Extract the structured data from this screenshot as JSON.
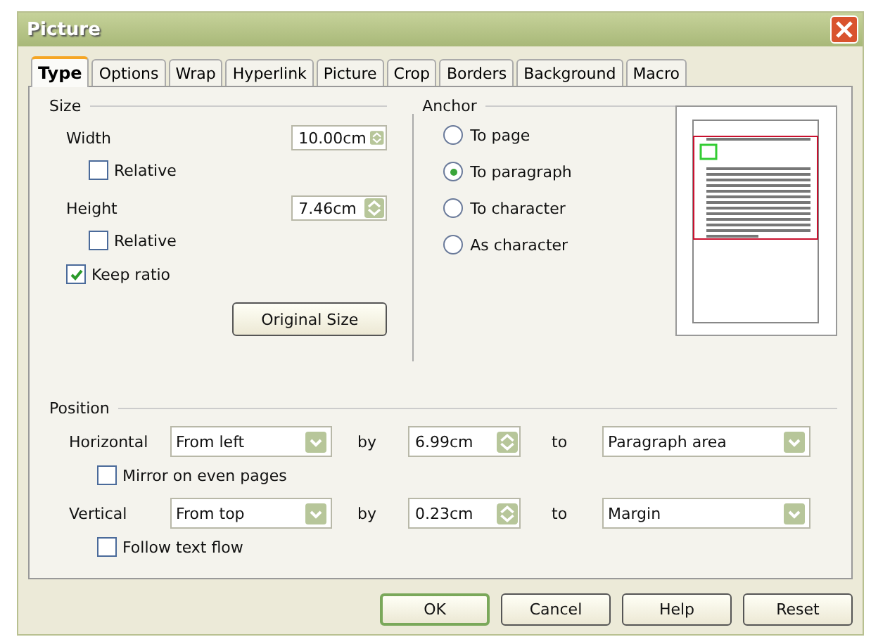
{
  "window": {
    "title": "Picture"
  },
  "tabs": [
    {
      "label": "Type",
      "selected": true
    },
    {
      "label": "Options",
      "selected": false
    },
    {
      "label": "Wrap",
      "selected": false
    },
    {
      "label": "Hyperlink",
      "selected": false
    },
    {
      "label": "Picture",
      "selected": false
    },
    {
      "label": "Crop",
      "selected": false
    },
    {
      "label": "Borders",
      "selected": false
    },
    {
      "label": "Background",
      "selected": false
    },
    {
      "label": "Macro",
      "selected": false
    }
  ],
  "size": {
    "label": "Size",
    "fields": [
      {
        "label": "Width",
        "value": "10.00cm",
        "relative": {
          "label": "Relative",
          "checked": false
        }
      },
      {
        "label": "Height",
        "value": "7.46cm",
        "relative": {
          "label": "Relative",
          "checked": false
        }
      }
    ],
    "keep_ratio": {
      "label": "Keep ratio",
      "checked": true
    },
    "original_size_button": "Original Size"
  },
  "anchor": {
    "label": "Anchor",
    "options": [
      {
        "label": "To page",
        "selected": false
      },
      {
        "label": "To paragraph",
        "selected": true
      },
      {
        "label": "To character",
        "selected": false
      },
      {
        "label": "As character",
        "selected": false
      }
    ]
  },
  "position": {
    "label": "Position",
    "rows": [
      {
        "label": "Horizontal",
        "from": "From left",
        "by_label": "by",
        "by_value": "6.99cm",
        "to_label": "to",
        "to": "Paragraph area",
        "option": {
          "label": "Mirror on even pages",
          "checked": false
        }
      },
      {
        "label": "Vertical",
        "from": "From top",
        "by_label": "by",
        "by_value": "0.23cm",
        "to_label": "to",
        "to": "Margin",
        "option": {
          "label": "Follow text flow",
          "checked": false
        }
      }
    ]
  },
  "buttons": [
    {
      "label": "OK",
      "default": true
    },
    {
      "label": "Cancel",
      "default": false
    },
    {
      "label": "Help",
      "default": false
    },
    {
      "label": "Reset",
      "default": false
    }
  ]
}
